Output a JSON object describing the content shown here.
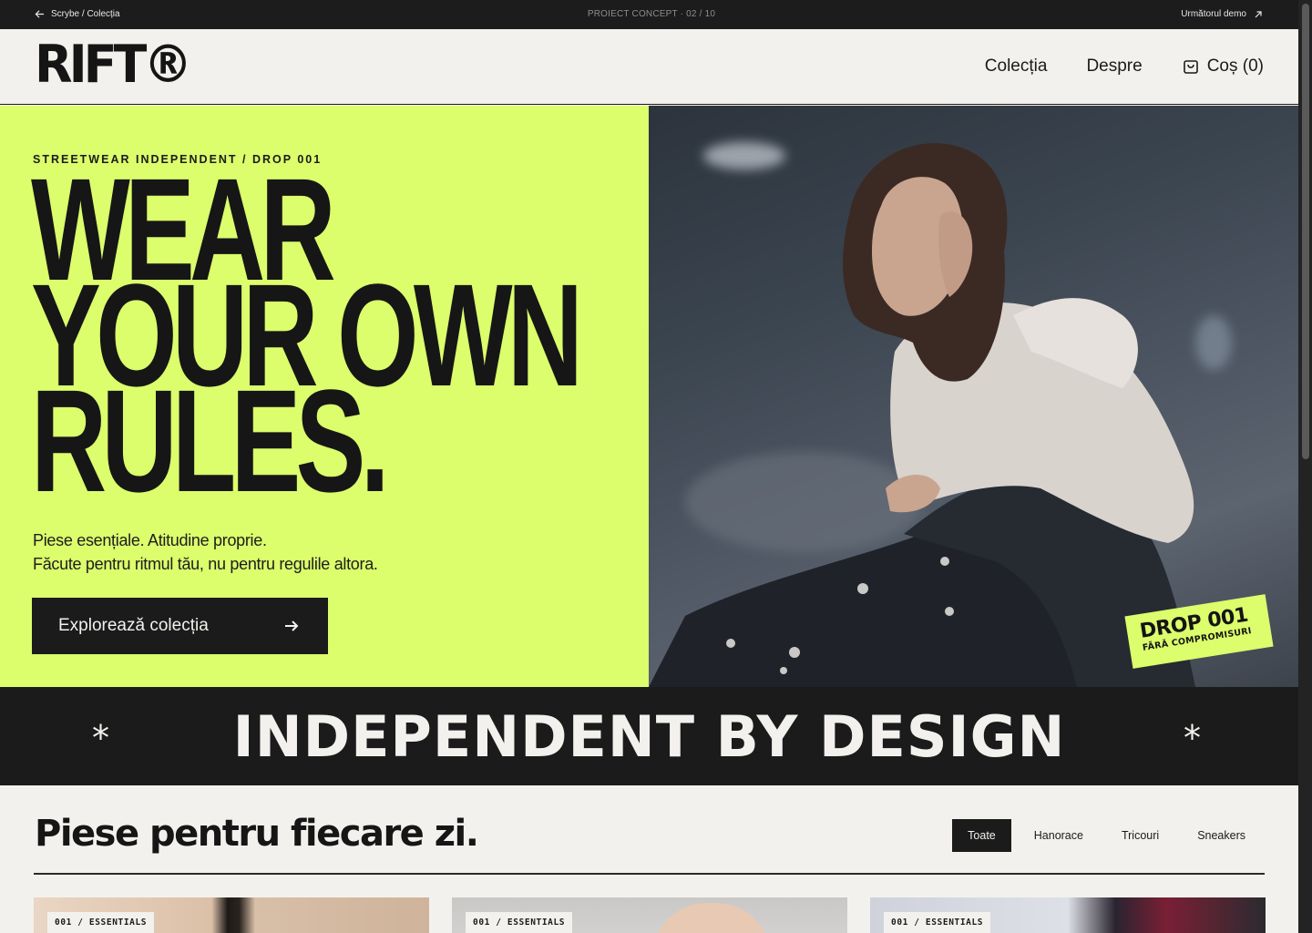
{
  "demo_bar": {
    "back_label": "Scrybe / Colecția",
    "center_label": "PROIECT CONCEPT · 02 / 10",
    "next_label": "Următorul demo"
  },
  "header": {
    "logo": "RIFT®",
    "nav": [
      "Colecția",
      "Despre"
    ],
    "cart_label": "Coș (0)"
  },
  "hero": {
    "eyebrow": "STREETWEAR INDEPENDENT / DROP 001",
    "headline_lines": [
      "WEAR",
      "YOUR OWN",
      "RULES."
    ],
    "sub_lines": [
      "Piese esențiale. Atitudine proprie.",
      "Făcute pentru ritmul tău, nu pentru regulile altora."
    ],
    "cta_label": "Explorează colecția",
    "sticker_title": "DROP 001",
    "sticker_sub": "FĂRĂ COMPROMISURI"
  },
  "band": {
    "text": "INDEPENDENT BY DESIGN",
    "star": "*"
  },
  "products": {
    "title": "Piese pentru fiecare zi.",
    "filters": [
      "Toate",
      "Hanorace",
      "Tricouri",
      "Sneakers"
    ],
    "active_filter": "Toate",
    "cards": [
      {
        "tag": "001 / ESSENTIALS"
      },
      {
        "tag": "001 / ESSENTIALS"
      },
      {
        "tag": "001 / ESSENTIALS"
      }
    ]
  },
  "colors": {
    "accent": "#dcfd6c",
    "dark": "#1b1b1b",
    "paper": "#f3f1ed"
  },
  "icons": {
    "back": "arrow-left-icon",
    "next": "arrow-up-right-icon",
    "cart": "shopping-bag-icon",
    "cta": "arrow-right-icon"
  }
}
